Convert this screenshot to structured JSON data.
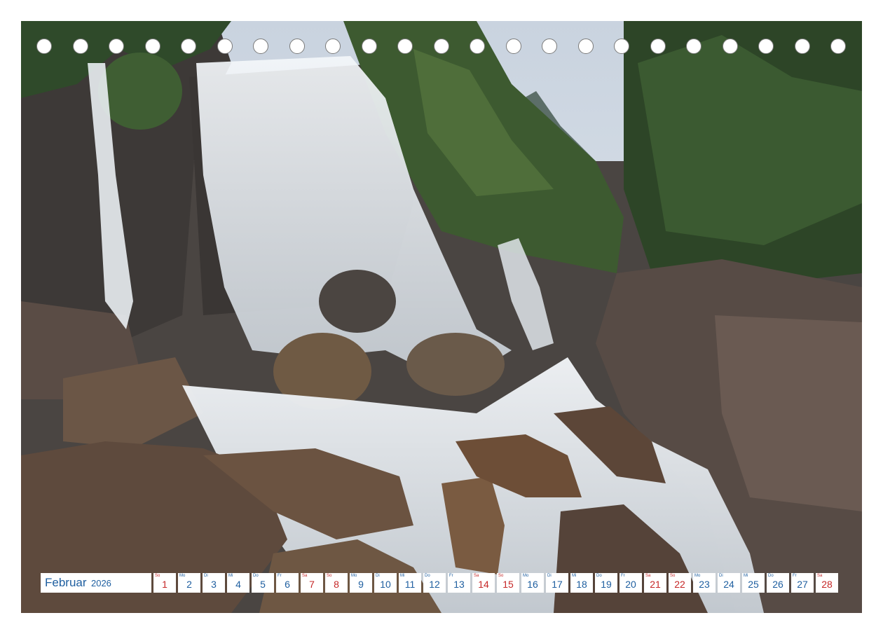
{
  "calendar": {
    "month": "Februar",
    "year": "2026",
    "colors": {
      "weekday": "#1f5fa0",
      "weekend": "#c62828"
    },
    "days": [
      {
        "wd": "So",
        "num": "1",
        "weekend": true
      },
      {
        "wd": "Mo",
        "num": "2",
        "weekend": false
      },
      {
        "wd": "Di",
        "num": "3",
        "weekend": false
      },
      {
        "wd": "Mi",
        "num": "4",
        "weekend": false
      },
      {
        "wd": "Do",
        "num": "5",
        "weekend": false
      },
      {
        "wd": "Fr",
        "num": "6",
        "weekend": false
      },
      {
        "wd": "Sa",
        "num": "7",
        "weekend": true
      },
      {
        "wd": "So",
        "num": "8",
        "weekend": true
      },
      {
        "wd": "Mo",
        "num": "9",
        "weekend": false
      },
      {
        "wd": "Di",
        "num": "10",
        "weekend": false
      },
      {
        "wd": "Mi",
        "num": "11",
        "weekend": false
      },
      {
        "wd": "Do",
        "num": "12",
        "weekend": false
      },
      {
        "wd": "Fr",
        "num": "13",
        "weekend": false
      },
      {
        "wd": "Sa",
        "num": "14",
        "weekend": true
      },
      {
        "wd": "So",
        "num": "15",
        "weekend": true
      },
      {
        "wd": "Mo",
        "num": "16",
        "weekend": false
      },
      {
        "wd": "Di",
        "num": "17",
        "weekend": false
      },
      {
        "wd": "Mi",
        "num": "18",
        "weekend": false
      },
      {
        "wd": "Do",
        "num": "19",
        "weekend": false
      },
      {
        "wd": "Fr",
        "num": "20",
        "weekend": false
      },
      {
        "wd": "Sa",
        "num": "21",
        "weekend": true
      },
      {
        "wd": "So",
        "num": "22",
        "weekend": true
      },
      {
        "wd": "Mo",
        "num": "23",
        "weekend": false
      },
      {
        "wd": "Di",
        "num": "24",
        "weekend": false
      },
      {
        "wd": "Mi",
        "num": "25",
        "weekend": false
      },
      {
        "wd": "Do",
        "num": "26",
        "weekend": false
      },
      {
        "wd": "Fr",
        "num": "27",
        "weekend": false
      },
      {
        "wd": "Sa",
        "num": "28",
        "weekend": true
      }
    ]
  },
  "photo": {
    "subject": "waterfall-photo"
  },
  "binding": {
    "hole_count": 23
  }
}
